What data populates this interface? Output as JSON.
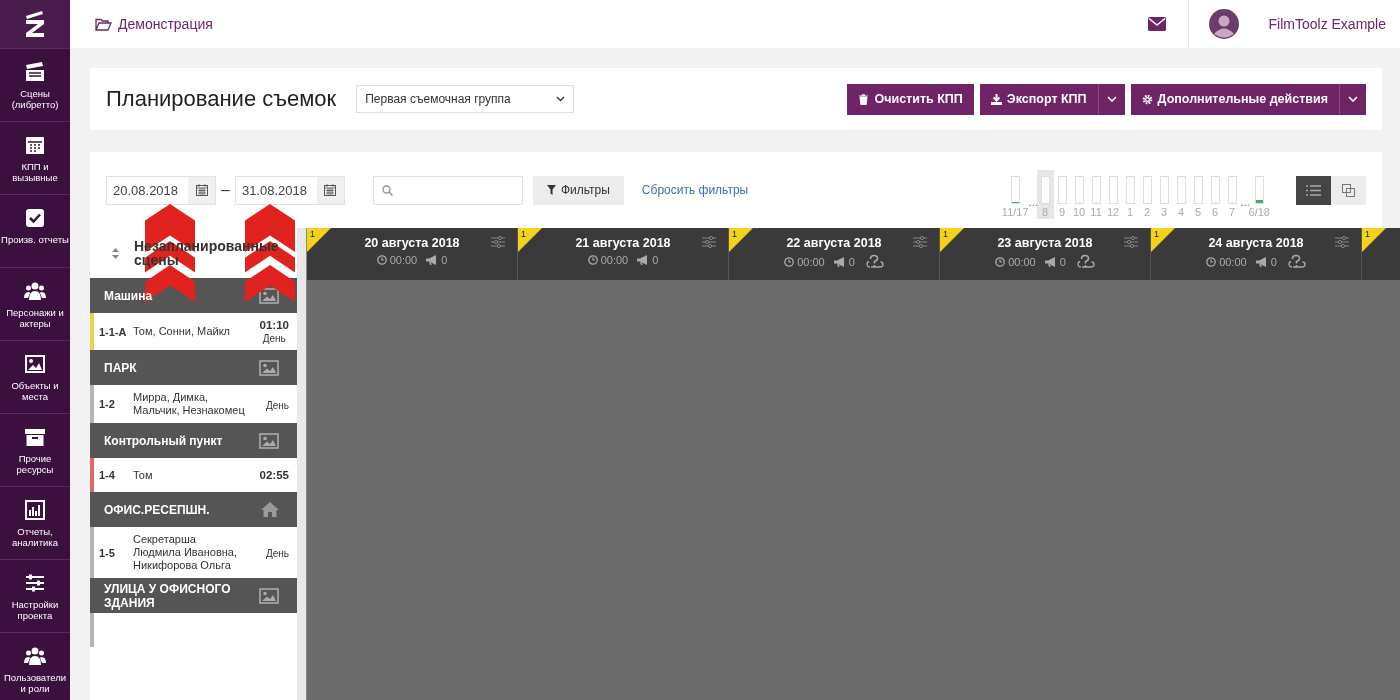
{
  "sidebar": {
    "items": [
      {
        "kind": "clapper",
        "label": "Сцены (либретто)",
        "selected": false
      },
      {
        "kind": "calendar",
        "label": "КПП и вызывные",
        "selected": false
      },
      {
        "kind": "check",
        "label": "Произв. отчеты",
        "selected": false
      },
      {
        "kind": "people",
        "label": "Персонажи и актеры",
        "selected": false
      },
      {
        "kind": "image",
        "label": "Объекты и места",
        "selected": false
      },
      {
        "kind": "archive",
        "label": "Прочие ресурсы",
        "selected": false
      },
      {
        "kind": "chart",
        "label": "Отчеты, аналитика",
        "selected": false
      },
      {
        "kind": "sliders",
        "label": "Настройки проекта",
        "selected": false
      },
      {
        "kind": "people",
        "label": "Пользователи и роли",
        "selected": false
      }
    ]
  },
  "topbar": {
    "breadcrumb": "Демонстрация",
    "user": "FilmToolz Example"
  },
  "header": {
    "title": "Планирование съемок",
    "group_select": "Первая съемочная группа",
    "buttons": [
      {
        "kind": "trash",
        "label": "Очистить КПП",
        "dropdown": false
      },
      {
        "kind": "download",
        "label": "Экспорт КПП",
        "dropdown": true
      },
      {
        "kind": "gear",
        "label": "Дополнительные действия",
        "dropdown": true
      }
    ]
  },
  "filters": {
    "date_from": "20.08.2018",
    "date_to": "31.08.2018",
    "date_separator": "–",
    "filters_button": "Фильтры",
    "reset_link": "Сбросить фильтры"
  },
  "timeline": [
    {
      "kind": "bar",
      "label": "11/17",
      "level": 0.03,
      "selected": false
    },
    {
      "kind": "ellipsis",
      "label": "..."
    },
    {
      "kind": "bar",
      "label": "8",
      "selected": true
    },
    {
      "kind": "bar",
      "label": "9",
      "selected": false
    },
    {
      "kind": "bar",
      "label": "10",
      "selected": false
    },
    {
      "kind": "bar",
      "label": "11",
      "selected": false
    },
    {
      "kind": "bar",
      "label": "12",
      "selected": false
    },
    {
      "kind": "bar",
      "label": "1",
      "selected": false
    },
    {
      "kind": "bar",
      "label": "2",
      "selected": false
    },
    {
      "kind": "bar",
      "label": "3",
      "selected": false
    },
    {
      "kind": "bar",
      "label": "4",
      "selected": false
    },
    {
      "kind": "bar",
      "label": "5",
      "selected": false
    },
    {
      "kind": "bar",
      "label": "6",
      "selected": false
    },
    {
      "kind": "bar",
      "label": "7",
      "selected": false
    },
    {
      "kind": "ellipsis",
      "label": "..."
    },
    {
      "kind": "bar",
      "label": "6/18",
      "level": 0.1,
      "selected": false
    }
  ],
  "view_toggle": [
    {
      "kind": "list",
      "selected": true
    },
    {
      "kind": "overlap",
      "selected": false
    }
  ],
  "unscheduled": {
    "title": "Незапланированные сцены",
    "groups": [
      {
        "name": "Машина",
        "kind": "picture",
        "rows": [
          {
            "code": "1-1-А",
            "cast": "Том, Сонни, Майкл",
            "time": "01:10",
            "daypart": "День",
            "color": "#e8d34f"
          }
        ]
      },
      {
        "name": "ПАРК",
        "kind": "picture",
        "rows": [
          {
            "code": "1-2",
            "cast": "Мирра, Димка, Мальчик, Незнакомец",
            "daypart": "День",
            "color": "#b5b5b5"
          }
        ]
      },
      {
        "name": "Контрольный пункт",
        "kind": "picture",
        "rows": [
          {
            "code": "1-4",
            "cast": "Том",
            "time": "02:55",
            "color": "#d9696b"
          }
        ]
      },
      {
        "name": "ОФИС.РЕСЕПШН.",
        "kind": "home",
        "rows": [
          {
            "code": "1-5",
            "cast": "Секретарша Людмила Ивановна, Никифорова Ольга",
            "daypart": "День",
            "color": "#b5b5b5"
          }
        ]
      },
      {
        "name": "УЛИЦА У ОФИСНОГО ЗДАНИЯ",
        "kind": "picture",
        "rows": [
          {
            "color": "#b5b5b5"
          }
        ]
      }
    ]
  },
  "days": [
    {
      "badge": "1",
      "date": "20 августа 2018",
      "time": "00:00",
      "count": "0",
      "weather": false
    },
    {
      "badge": "1",
      "date": "21 августа 2018",
      "time": "00:00",
      "count": "0",
      "weather": false
    },
    {
      "badge": "1",
      "date": "22 августа 2018",
      "time": "00:00",
      "count": "0",
      "weather": true
    },
    {
      "badge": "1",
      "date": "23 августа 2018",
      "time": "00:00",
      "count": "0",
      "weather": true
    },
    {
      "badge": "1",
      "date": "24 августа 2018",
      "time": "00:00",
      "count": "0",
      "weather": true
    },
    {
      "badge": "1"
    }
  ]
}
